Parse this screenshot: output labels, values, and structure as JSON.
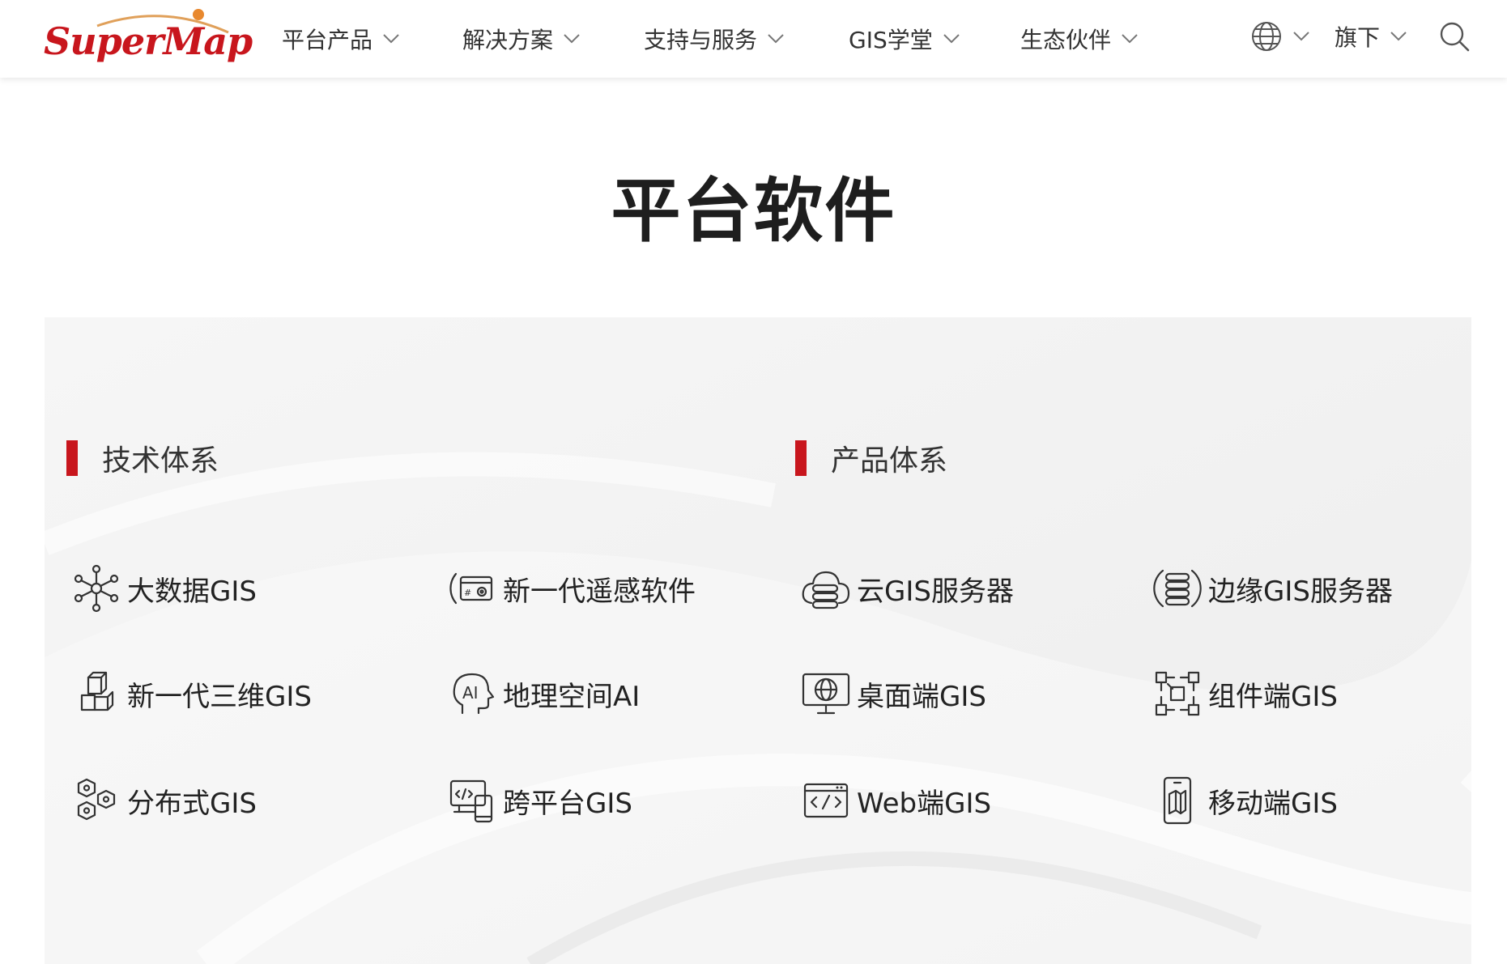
{
  "header": {
    "logo_text": "SuperMap",
    "nav": [
      {
        "label": "平台产品"
      },
      {
        "label": "解决方案"
      },
      {
        "label": "支持与服务"
      },
      {
        "label": "GIS学堂"
      },
      {
        "label": "生态伙伴"
      }
    ],
    "language_icon": "globe-icon",
    "flagship_label": "旗下",
    "search_icon": "search-icon"
  },
  "page": {
    "title": "平台软件"
  },
  "sections": {
    "tech": {
      "title": "技术体系",
      "items": [
        {
          "label": "大数据GIS",
          "icon": "network-nodes-icon"
        },
        {
          "label": "新一代遥感软件",
          "icon": "remote-sensing-icon"
        },
        {
          "label": "新一代三维GIS",
          "icon": "cubes-icon"
        },
        {
          "label": "地理空间AI",
          "icon": "ai-head-icon"
        },
        {
          "label": "分布式GIS",
          "icon": "hexagons-icon"
        },
        {
          "label": "跨平台GIS",
          "icon": "devices-icon"
        }
      ]
    },
    "product": {
      "title": "产品体系",
      "items": [
        {
          "label": "云GIS服务器",
          "icon": "cloud-server-icon"
        },
        {
          "label": "边缘GIS服务器",
          "icon": "edge-server-icon"
        },
        {
          "label": "桌面端GIS",
          "icon": "desktop-globe-icon"
        },
        {
          "label": "组件端GIS",
          "icon": "components-icon"
        },
        {
          "label": "Web端GIS",
          "icon": "web-code-icon"
        },
        {
          "label": "移动端GIS",
          "icon": "mobile-map-icon"
        }
      ]
    }
  },
  "colors": {
    "brand_red": "#c8161d",
    "panel_bg": "#f3f3f3",
    "text": "#222222"
  }
}
